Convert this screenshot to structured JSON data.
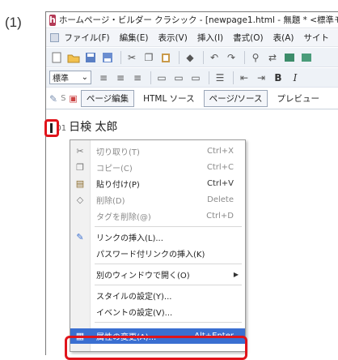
{
  "step_label": "(1)",
  "window": {
    "title": "ホームページ・ビルダー クラシック - [newpage1.html - 無題 * <標準モード",
    "menu": [
      "ファイル(F)",
      "編集(E)",
      "表示(V)",
      "挿入(I)",
      "書式(O)",
      "表(A)",
      "サイト"
    ],
    "style_select_value": "標準",
    "tabs": [
      "ページ編集",
      "HTML ソース",
      "ページ/ソース",
      "プレビュー"
    ],
    "active_tab": "ページ編集"
  },
  "document": {
    "line_number": "001",
    "text": "日検 太郎"
  },
  "context_menu": [
    {
      "label": "切り取り(T)",
      "shortcut": "Ctrl+X",
      "disabled": true,
      "icon": "scissors-icon"
    },
    {
      "label": "コピー(C)",
      "shortcut": "Ctrl+C",
      "disabled": true,
      "icon": "copy-icon"
    },
    {
      "label": "貼り付け(P)",
      "shortcut": "Ctrl+V",
      "disabled": false,
      "icon": "paste-icon"
    },
    {
      "label": "削除(D)",
      "shortcut": "Delete",
      "disabled": true,
      "icon": "eraser-icon"
    },
    {
      "label": "タグを削除(@)",
      "shortcut": "Ctrl+D",
      "disabled": true,
      "icon": ""
    },
    {
      "label": "リンクの挿入(L)...",
      "shortcut": "",
      "disabled": false,
      "icon": "insert-link-icon"
    },
    {
      "label": "パスワード付リンクの挿入(K)",
      "shortcut": "",
      "disabled": false,
      "icon": ""
    },
    {
      "label": "別のウィンドウで開く(O)",
      "shortcut": "",
      "disabled": false,
      "icon": "",
      "submenu": true
    },
    {
      "label": "スタイルの設定(Y)...",
      "shortcut": "",
      "disabled": false,
      "icon": ""
    },
    {
      "label": "イベントの設定(V)...",
      "shortcut": "",
      "disabled": false,
      "icon": ""
    },
    {
      "label": "属性の変更(A)...",
      "shortcut": "Alt+Enter",
      "disabled": false,
      "icon": "properties-icon",
      "highlighted": true
    }
  ],
  "colors": {
    "highlight": "#3a6fd1",
    "annotation_red": "#e0141b"
  }
}
